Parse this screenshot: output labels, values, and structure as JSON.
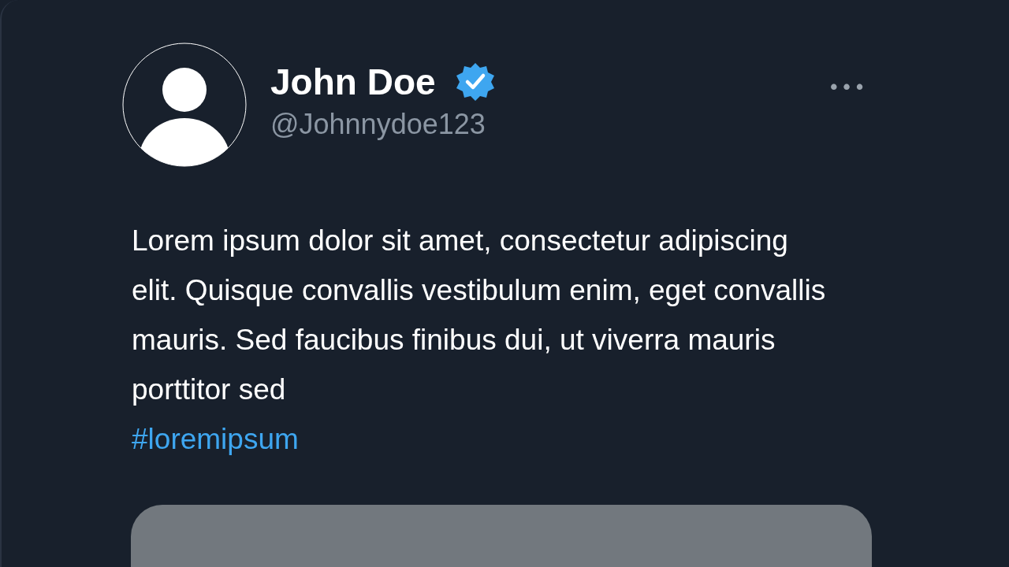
{
  "post": {
    "author": {
      "name": "John Doe",
      "verified": true,
      "handle": "@Johnnydoe123"
    },
    "menu_icon": "• • •",
    "text": "Lorem ipsum dolor sit amet, consectetur adipiscing elit. Quisque convallis vestibulum enim, eget convallis mauris. Sed faucibus finibus dui, ut viverra mauris porttitor sed",
    "hashtag": "#loremipsum"
  }
}
